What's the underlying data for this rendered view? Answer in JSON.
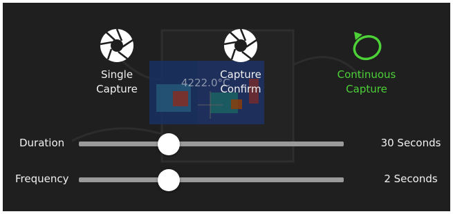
{
  "modes": [
    {
      "label": "Single\nCapture",
      "icon": "shutter-icon",
      "active": false
    },
    {
      "label": "Capture\nConfirm",
      "icon": "shutter-icon",
      "active": false
    },
    {
      "label": "Continuous\nCapture",
      "icon": "refresh-cycle-icon",
      "active": true
    }
  ],
  "camera": {
    "temperature_readout": "4222.0°C"
  },
  "sliders": {
    "duration": {
      "label": "Duration",
      "value_text": "30 Seconds",
      "level": 0.34
    },
    "frequency": {
      "label": "Frequency",
      "value_text": "2 Seconds",
      "level": 0.34
    }
  },
  "colors": {
    "active": "#4cd137",
    "text": "#f2f2f2",
    "track": "#9a9a9a"
  }
}
